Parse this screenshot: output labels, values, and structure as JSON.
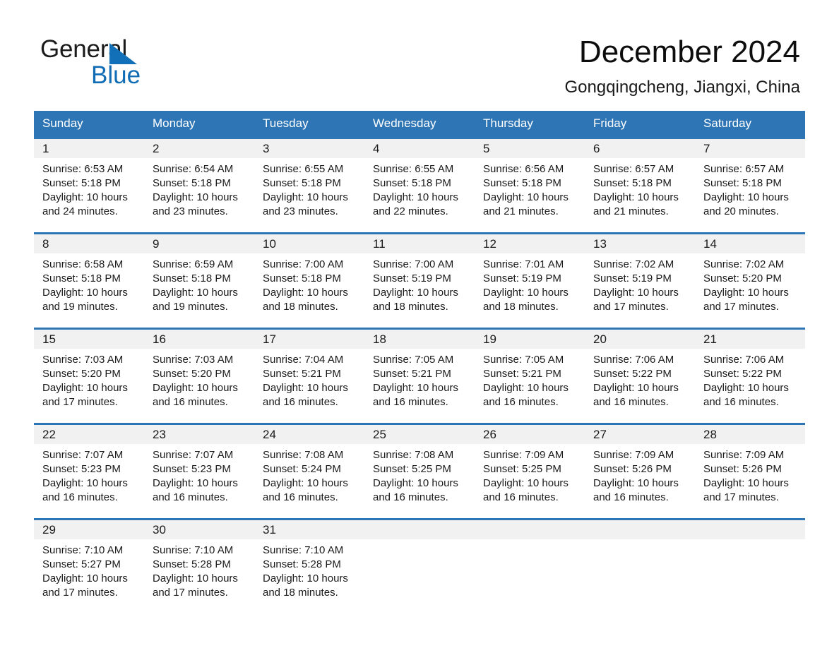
{
  "brand": {
    "name_part1": "General",
    "name_part2": "Blue",
    "triangle_color": "#1270b8",
    "blue_color": "#0f6cb5"
  },
  "header": {
    "title": "December 2024",
    "location": "Gongqingcheng, Jiangxi, China"
  },
  "theme": {
    "header_blue": "#2e75b6",
    "daynum_band": "#f1f1f1",
    "text": "#1a1a1a"
  },
  "calendar": {
    "weekdays": [
      "Sunday",
      "Monday",
      "Tuesday",
      "Wednesday",
      "Thursday",
      "Friday",
      "Saturday"
    ],
    "weeks": [
      [
        {
          "day": "1",
          "sunrise": "Sunrise: 6:53 AM",
          "sunset": "Sunset: 5:18 PM",
          "daylight": "Daylight: 10 hours and 24 minutes."
        },
        {
          "day": "2",
          "sunrise": "Sunrise: 6:54 AM",
          "sunset": "Sunset: 5:18 PM",
          "daylight": "Daylight: 10 hours and 23 minutes."
        },
        {
          "day": "3",
          "sunrise": "Sunrise: 6:55 AM",
          "sunset": "Sunset: 5:18 PM",
          "daylight": "Daylight: 10 hours and 23 minutes."
        },
        {
          "day": "4",
          "sunrise": "Sunrise: 6:55 AM",
          "sunset": "Sunset: 5:18 PM",
          "daylight": "Daylight: 10 hours and 22 minutes."
        },
        {
          "day": "5",
          "sunrise": "Sunrise: 6:56 AM",
          "sunset": "Sunset: 5:18 PM",
          "daylight": "Daylight: 10 hours and 21 minutes."
        },
        {
          "day": "6",
          "sunrise": "Sunrise: 6:57 AM",
          "sunset": "Sunset: 5:18 PM",
          "daylight": "Daylight: 10 hours and 21 minutes."
        },
        {
          "day": "7",
          "sunrise": "Sunrise: 6:57 AM",
          "sunset": "Sunset: 5:18 PM",
          "daylight": "Daylight: 10 hours and 20 minutes."
        }
      ],
      [
        {
          "day": "8",
          "sunrise": "Sunrise: 6:58 AM",
          "sunset": "Sunset: 5:18 PM",
          "daylight": "Daylight: 10 hours and 19 minutes."
        },
        {
          "day": "9",
          "sunrise": "Sunrise: 6:59 AM",
          "sunset": "Sunset: 5:18 PM",
          "daylight": "Daylight: 10 hours and 19 minutes."
        },
        {
          "day": "10",
          "sunrise": "Sunrise: 7:00 AM",
          "sunset": "Sunset: 5:18 PM",
          "daylight": "Daylight: 10 hours and 18 minutes."
        },
        {
          "day": "11",
          "sunrise": "Sunrise: 7:00 AM",
          "sunset": "Sunset: 5:19 PM",
          "daylight": "Daylight: 10 hours and 18 minutes."
        },
        {
          "day": "12",
          "sunrise": "Sunrise: 7:01 AM",
          "sunset": "Sunset: 5:19 PM",
          "daylight": "Daylight: 10 hours and 18 minutes."
        },
        {
          "day": "13",
          "sunrise": "Sunrise: 7:02 AM",
          "sunset": "Sunset: 5:19 PM",
          "daylight": "Daylight: 10 hours and 17 minutes."
        },
        {
          "day": "14",
          "sunrise": "Sunrise: 7:02 AM",
          "sunset": "Sunset: 5:20 PM",
          "daylight": "Daylight: 10 hours and 17 minutes."
        }
      ],
      [
        {
          "day": "15",
          "sunrise": "Sunrise: 7:03 AM",
          "sunset": "Sunset: 5:20 PM",
          "daylight": "Daylight: 10 hours and 17 minutes."
        },
        {
          "day": "16",
          "sunrise": "Sunrise: 7:03 AM",
          "sunset": "Sunset: 5:20 PM",
          "daylight": "Daylight: 10 hours and 16 minutes."
        },
        {
          "day": "17",
          "sunrise": "Sunrise: 7:04 AM",
          "sunset": "Sunset: 5:21 PM",
          "daylight": "Daylight: 10 hours and 16 minutes."
        },
        {
          "day": "18",
          "sunrise": "Sunrise: 7:05 AM",
          "sunset": "Sunset: 5:21 PM",
          "daylight": "Daylight: 10 hours and 16 minutes."
        },
        {
          "day": "19",
          "sunrise": "Sunrise: 7:05 AM",
          "sunset": "Sunset: 5:21 PM",
          "daylight": "Daylight: 10 hours and 16 minutes."
        },
        {
          "day": "20",
          "sunrise": "Sunrise: 7:06 AM",
          "sunset": "Sunset: 5:22 PM",
          "daylight": "Daylight: 10 hours and 16 minutes."
        },
        {
          "day": "21",
          "sunrise": "Sunrise: 7:06 AM",
          "sunset": "Sunset: 5:22 PM",
          "daylight": "Daylight: 10 hours and 16 minutes."
        }
      ],
      [
        {
          "day": "22",
          "sunrise": "Sunrise: 7:07 AM",
          "sunset": "Sunset: 5:23 PM",
          "daylight": "Daylight: 10 hours and 16 minutes."
        },
        {
          "day": "23",
          "sunrise": "Sunrise: 7:07 AM",
          "sunset": "Sunset: 5:23 PM",
          "daylight": "Daylight: 10 hours and 16 minutes."
        },
        {
          "day": "24",
          "sunrise": "Sunrise: 7:08 AM",
          "sunset": "Sunset: 5:24 PM",
          "daylight": "Daylight: 10 hours and 16 minutes."
        },
        {
          "day": "25",
          "sunrise": "Sunrise: 7:08 AM",
          "sunset": "Sunset: 5:25 PM",
          "daylight": "Daylight: 10 hours and 16 minutes."
        },
        {
          "day": "26",
          "sunrise": "Sunrise: 7:09 AM",
          "sunset": "Sunset: 5:25 PM",
          "daylight": "Daylight: 10 hours and 16 minutes."
        },
        {
          "day": "27",
          "sunrise": "Sunrise: 7:09 AM",
          "sunset": "Sunset: 5:26 PM",
          "daylight": "Daylight: 10 hours and 16 minutes."
        },
        {
          "day": "28",
          "sunrise": "Sunrise: 7:09 AM",
          "sunset": "Sunset: 5:26 PM",
          "daylight": "Daylight: 10 hours and 17 minutes."
        }
      ],
      [
        {
          "day": "29",
          "sunrise": "Sunrise: 7:10 AM",
          "sunset": "Sunset: 5:27 PM",
          "daylight": "Daylight: 10 hours and 17 minutes."
        },
        {
          "day": "30",
          "sunrise": "Sunrise: 7:10 AM",
          "sunset": "Sunset: 5:28 PM",
          "daylight": "Daylight: 10 hours and 17 minutes."
        },
        {
          "day": "31",
          "sunrise": "Sunrise: 7:10 AM",
          "sunset": "Sunset: 5:28 PM",
          "daylight": "Daylight: 10 hours and 18 minutes."
        },
        {
          "day": "",
          "sunrise": "",
          "sunset": "",
          "daylight": ""
        },
        {
          "day": "",
          "sunrise": "",
          "sunset": "",
          "daylight": ""
        },
        {
          "day": "",
          "sunrise": "",
          "sunset": "",
          "daylight": ""
        },
        {
          "day": "",
          "sunrise": "",
          "sunset": "",
          "daylight": ""
        }
      ]
    ]
  }
}
